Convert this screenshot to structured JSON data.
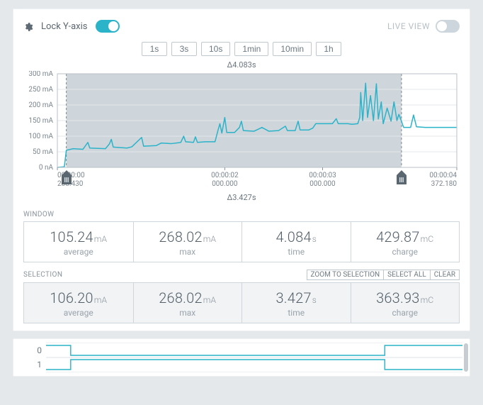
{
  "header": {
    "lock_y_axis_label": "Lock Y-axis",
    "lock_y_axis_on": true,
    "live_view_label": "LIVE VIEW",
    "live_view_on": false
  },
  "time_buttons": [
    "1s",
    "3s",
    "10s",
    "1min",
    "10min",
    "1h"
  ],
  "delta_window_label": "Δ4.083s",
  "delta_selection_label": "Δ3.427s",
  "chart_data": {
    "type": "line",
    "title": "",
    "xlabel": "",
    "ylabel": "",
    "y_unit": "mA",
    "y_ticks": [
      {
        "label": "0 nA",
        "value": 0
      },
      {
        "label": "50 mA",
        "value": 50
      },
      {
        "label": "100 mA",
        "value": 100
      },
      {
        "label": "150 mA",
        "value": 150
      },
      {
        "label": "200 mA",
        "value": 200
      },
      {
        "label": "250 mA",
        "value": 250
      },
      {
        "label": "300 mA",
        "value": 300
      }
    ],
    "ylim": [
      0,
      300
    ],
    "x_ticks": [
      {
        "top": "00:00:00",
        "bottom": "288.430",
        "t": 0.28843
      },
      {
        "top": "00:00:02",
        "bottom": "000.000",
        "t": 2.0
      },
      {
        "top": "00:00:03",
        "bottom": "000.000",
        "t": 3.0
      },
      {
        "top": "00:00:04",
        "bottom": "372.180",
        "t": 4.37218
      }
    ],
    "xlim": [
      0.28843,
      4.37218
    ],
    "selection": {
      "t_start": 0.38,
      "t_end": 3.807
    },
    "series": [
      {
        "name": "current",
        "color": "#2ab3c9",
        "points": [
          [
            0.28843,
            0
          ],
          [
            0.36,
            2
          ],
          [
            0.38,
            55
          ],
          [
            0.45,
            60
          ],
          [
            0.55,
            58
          ],
          [
            0.6,
            80
          ],
          [
            0.62,
            62
          ],
          [
            0.78,
            60
          ],
          [
            0.82,
            75
          ],
          [
            0.84,
            90
          ],
          [
            0.86,
            65
          ],
          [
            1.0,
            62
          ],
          [
            1.05,
            66
          ],
          [
            1.15,
            96
          ],
          [
            1.17,
            68
          ],
          [
            1.3,
            70
          ],
          [
            1.35,
            78
          ],
          [
            1.45,
            76
          ],
          [
            1.55,
            80
          ],
          [
            1.58,
            100
          ],
          [
            1.6,
            82
          ],
          [
            1.68,
            80
          ],
          [
            1.7,
            98
          ],
          [
            1.72,
            80
          ],
          [
            1.8,
            82
          ],
          [
            1.9,
            82
          ],
          [
            1.93,
            118
          ],
          [
            1.95,
            140
          ],
          [
            1.97,
            110
          ],
          [
            2.0,
            160
          ],
          [
            2.02,
            112
          ],
          [
            2.1,
            112
          ],
          [
            2.15,
            128
          ],
          [
            2.17,
            148
          ],
          [
            2.19,
            118
          ],
          [
            2.3,
            116
          ],
          [
            2.38,
            128
          ],
          [
            2.45,
            116
          ],
          [
            2.55,
            118
          ],
          [
            2.62,
            132
          ],
          [
            2.64,
            118
          ],
          [
            2.72,
            118
          ],
          [
            2.75,
            148
          ],
          [
            2.77,
            120
          ],
          [
            2.86,
            120
          ],
          [
            2.9,
            126
          ],
          [
            2.93,
            140
          ],
          [
            3.0,
            140
          ],
          [
            3.1,
            140
          ],
          [
            3.14,
            156
          ],
          [
            3.16,
            140
          ],
          [
            3.26,
            140
          ],
          [
            3.3,
            138
          ],
          [
            3.36,
            140
          ],
          [
            3.38,
            160
          ],
          [
            3.39,
            240
          ],
          [
            3.41,
            150
          ],
          [
            3.44,
            270
          ],
          [
            3.46,
            160
          ],
          [
            3.49,
            230
          ],
          [
            3.52,
            150
          ],
          [
            3.55,
            268
          ],
          [
            3.57,
            155
          ],
          [
            3.6,
            210
          ],
          [
            3.62,
            140
          ],
          [
            3.66,
            190
          ],
          [
            3.7,
            148
          ],
          [
            3.73,
            210
          ],
          [
            3.76,
            150
          ],
          [
            3.78,
            170
          ],
          [
            3.81,
            145
          ],
          [
            3.82,
            135
          ],
          [
            3.83,
            128
          ],
          [
            3.9,
            128
          ],
          [
            3.93,
            168
          ],
          [
            3.96,
            130
          ],
          [
            4.05,
            128
          ],
          [
            4.15,
            128
          ],
          [
            4.25,
            128
          ],
          [
            4.37218,
            128
          ]
        ]
      }
    ]
  },
  "window_stats": {
    "label": "WINDOW",
    "cells": [
      {
        "value": "105.24",
        "unit": "mA",
        "name": "average"
      },
      {
        "value": "268.02",
        "unit": "mA",
        "name": "max"
      },
      {
        "value": "4.084",
        "unit": "s",
        "name": "time"
      },
      {
        "value": "429.87",
        "unit": "mC",
        "name": "charge"
      }
    ]
  },
  "selection_stats": {
    "label": "SELECTION",
    "actions": [
      "ZOOM TO SELECTION",
      "SELECT ALL",
      "CLEAR"
    ],
    "cells": [
      {
        "value": "106.20",
        "unit": "mA",
        "name": "average"
      },
      {
        "value": "268.02",
        "unit": "mA",
        "name": "max"
      },
      {
        "value": "3.427",
        "unit": "s",
        "name": "time"
      },
      {
        "value": "363.93",
        "unit": "mC",
        "name": "charge"
      }
    ]
  },
  "digital": {
    "channels": [
      {
        "label": "0",
        "edges": [
          [
            0.0,
            1
          ],
          [
            0.53,
            0
          ],
          [
            3.61,
            1
          ],
          [
            4.37218,
            1
          ]
        ]
      },
      {
        "label": "1",
        "edges": [
          [
            0.0,
            0
          ],
          [
            0.53,
            1
          ],
          [
            3.61,
            0
          ],
          [
            4.37218,
            0
          ]
        ]
      }
    ],
    "xlim": [
      0.28843,
      4.37218
    ]
  }
}
